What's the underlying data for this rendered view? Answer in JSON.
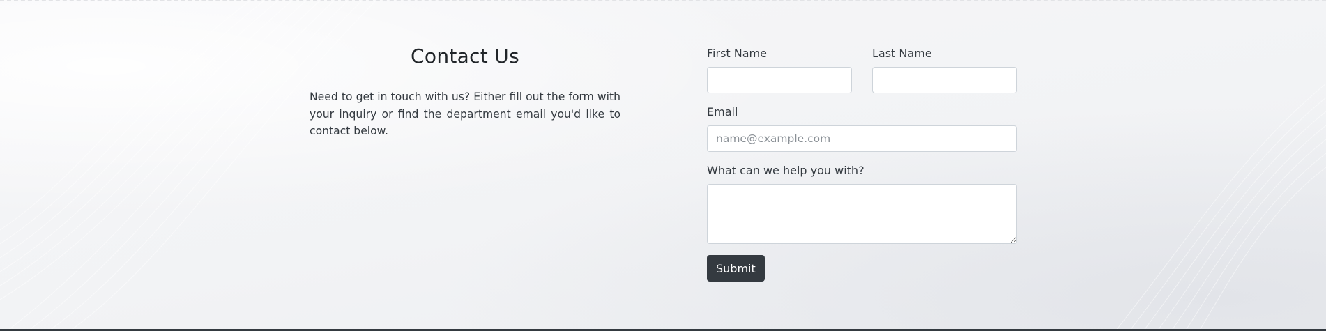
{
  "contact": {
    "title": "Contact Us",
    "intro": "Need to get in touch with us? Either fill out the form with your inquiry or find the department email you'd like to contact below."
  },
  "form": {
    "first_name": {
      "label": "First Name",
      "value": "",
      "placeholder": ""
    },
    "last_name": {
      "label": "Last Name",
      "value": "",
      "placeholder": ""
    },
    "email": {
      "label": "Email",
      "value": "",
      "placeholder": "name@example.com"
    },
    "message": {
      "label": "What can we help you with?",
      "value": "",
      "placeholder": ""
    },
    "submit_label": "Submit"
  },
  "colors": {
    "button_bg": "#343a40",
    "button_text": "#ffffff",
    "input_border": "#ced4da",
    "page_bg": "#f3f4f6"
  }
}
